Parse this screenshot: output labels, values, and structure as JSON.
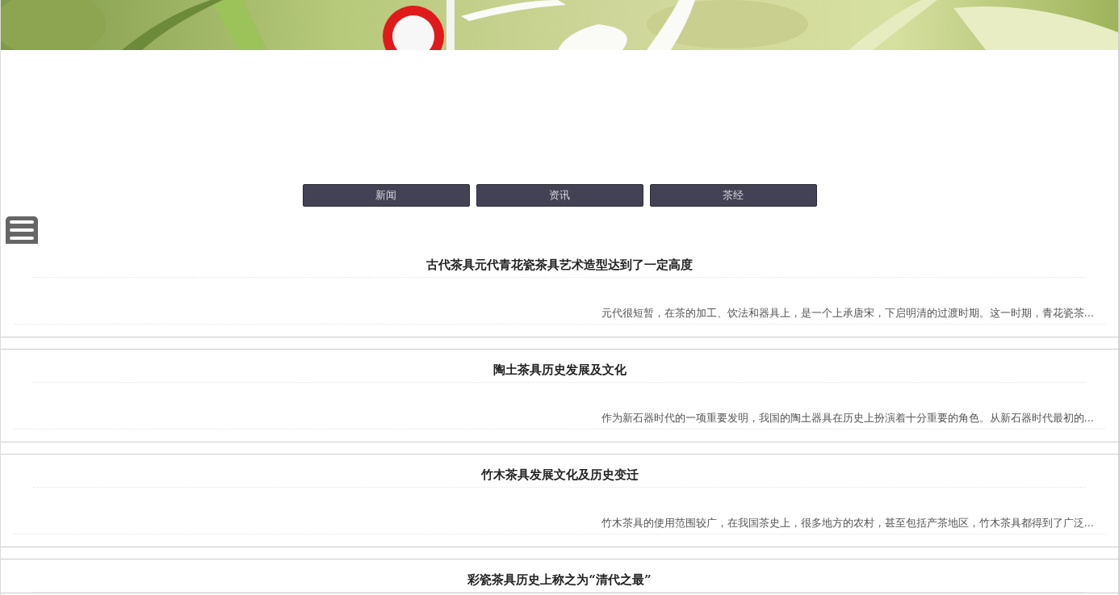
{
  "nav": [
    {
      "label": "新闻"
    },
    {
      "label": "资讯"
    },
    {
      "label": "茶经"
    }
  ],
  "articles": [
    {
      "title": "古代茶具元代青花瓷茶具艺术造型达到了一定高度",
      "summary": "元代很短暂，在茶的加工、饮法和器具上，是一个上承唐宋，下启明清的过渡时期。这一时期，青花瓷茶..."
    },
    {
      "title": "陶土茶具历史发展及文化",
      "summary": "作为新石器时代的一项重要发明，我国的陶土器具在历史上扮演着十分重要的角色。从新石器时代最初的..."
    },
    {
      "title": "竹木茶具发展文化及历史变迁",
      "summary": "竹木茶具的使用范围较广，在我国茶史上，很多地方的农村，甚至包括产茶地区，竹木茶具都得到了广泛..."
    },
    {
      "title": "彩瓷茶具历史上称之为“清代之最”"
    }
  ]
}
